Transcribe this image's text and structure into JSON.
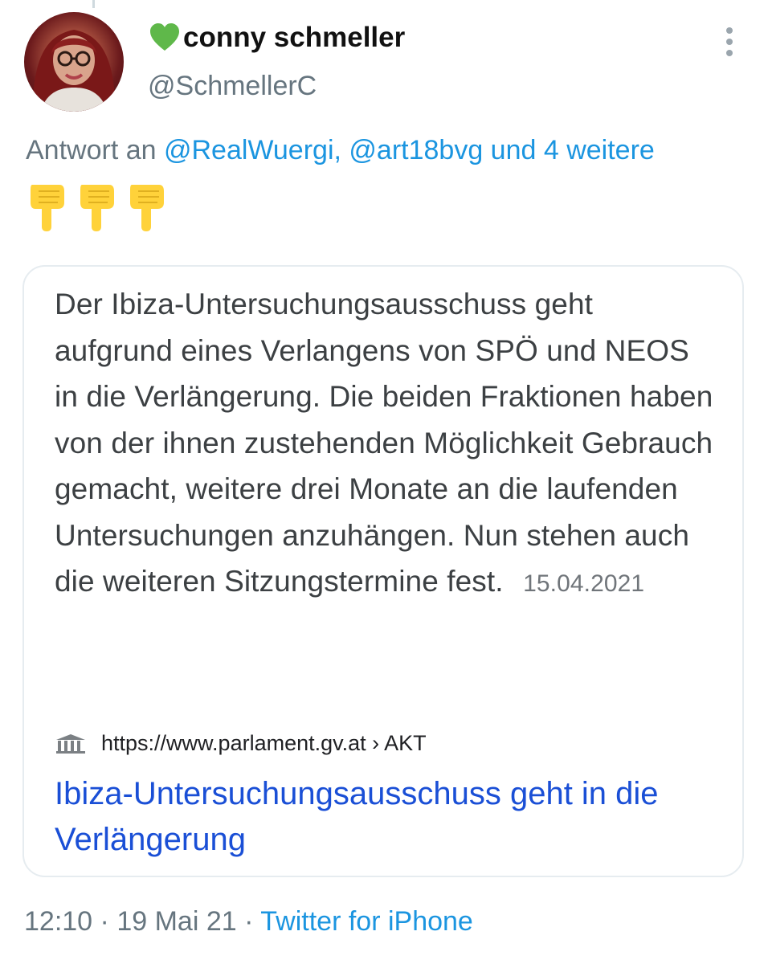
{
  "author": {
    "display_name": "conny schmeller",
    "handle": "@SchmellerC",
    "name_emoji": "green-heart"
  },
  "reply": {
    "prefix": "Antwort an",
    "mentions": "@RealWuergi, @art18bvg und 4 weitere"
  },
  "emoji": [
    "backhand-index-pointing-down",
    "backhand-index-pointing-down",
    "backhand-index-pointing-down"
  ],
  "card": {
    "snippet": "Der Ibiza-Untersuchungsausschuss geht aufgrund eines Verlangens von SPÖ und NEOS in die Verlängerung. Die beiden Fraktionen haben von der ihnen zustehenden Möglichkeit Gebrauch gemacht, weitere drei Monate an die laufenden Untersuchungen anzuhängen. Nun stehen auch die weiteren Sitzungstermine fest.",
    "date": "15.04.2021",
    "source": "https://www.parlament.gv.at › AKT",
    "title": "Ibiza-Untersuchungsausschuss geht in die Verlängerung"
  },
  "footer": {
    "time": "12:10",
    "separator": "·",
    "date": "19 Mai 21",
    "client": "Twitter for iPhone"
  },
  "colors": {
    "link": "#1b95e0",
    "muted": "#66757f",
    "result_title": "#1a4fd6",
    "heart": "#5fb84a",
    "emoji_yellow": "#ffd23a"
  }
}
